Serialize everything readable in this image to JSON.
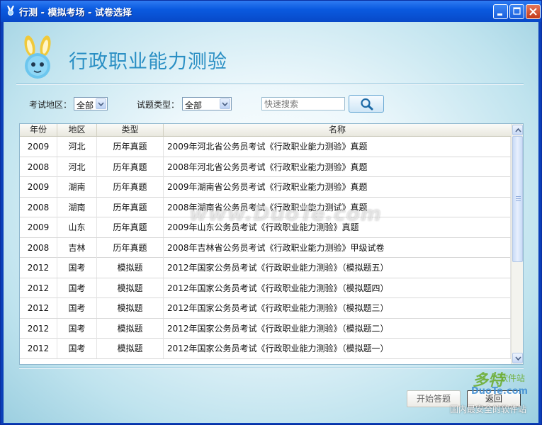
{
  "window": {
    "title": "行测 - 模拟考场 - 试卷选择",
    "controls": [
      "minimize",
      "maximize",
      "close"
    ]
  },
  "header": {
    "logo_icon": "rabbit-logo-icon",
    "title": "行政职业能力测验"
  },
  "filters": {
    "region_label": "考试地区：",
    "region_value": "全部",
    "type_label": "试题类型：",
    "type_value": "全部",
    "search_placeholder": "快速搜索",
    "search_icon": "search-icon"
  },
  "table": {
    "columns": [
      "年份",
      "地区",
      "类型",
      "名称"
    ],
    "rows": [
      {
        "year": "2009",
        "region": "河北",
        "type": "历年真题",
        "name": "2009年河北省公务员考试《行政职业能力测验》真题"
      },
      {
        "year": "2008",
        "region": "河北",
        "type": "历年真题",
        "name": "2008年河北省公务员考试《行政职业能力测验》真题"
      },
      {
        "year": "2009",
        "region": "湖南",
        "type": "历年真题",
        "name": "2009年湖南省公务员考试《行政职业能力测验》真题"
      },
      {
        "year": "2008",
        "region": "湖南",
        "type": "历年真题",
        "name": "2008年湖南省公务员考试《行政职业能力测试》真题"
      },
      {
        "year": "2009",
        "region": "山东",
        "type": "历年真题",
        "name": "2009年山东公务员考试《行政职业能力测验》真题"
      },
      {
        "year": "2008",
        "region": "吉林",
        "type": "历年真题",
        "name": "2008年吉林省公务员考试《行政职业能力测验》甲级试卷"
      },
      {
        "year": "2012",
        "region": "国考",
        "type": "模拟题",
        "name": "2012年国家公务员考试《行政职业能力测验》（模拟题五）"
      },
      {
        "year": "2012",
        "region": "国考",
        "type": "模拟题",
        "name": "2012年国家公务员考试《行政职业能力测验》（模拟题四）"
      },
      {
        "year": "2012",
        "region": "国考",
        "type": "模拟题",
        "name": "2012年国家公务员考试《行政职业能力测验》（模拟题三）"
      },
      {
        "year": "2012",
        "region": "国考",
        "type": "模拟题",
        "name": "2012年国家公务员考试《行政职业能力测验》（模拟题二）"
      },
      {
        "year": "2012",
        "region": "国考",
        "type": "模拟题",
        "name": "2012年国家公务员考试《行政职业能力测验》（模拟题一）"
      }
    ]
  },
  "buttons": {
    "start": "开始答题",
    "back": "返回"
  },
  "watermarks": {
    "center": "www.DuoTe.com",
    "brand": "多特",
    "brand_sub": "软件站",
    "domain": "DuoTe.com",
    "slogan": "国内最安全的软件站"
  },
  "colors": {
    "title_bar": "#0a5ae0",
    "heading": "#2a8fc4",
    "background_edge": "#9ccfe0"
  }
}
